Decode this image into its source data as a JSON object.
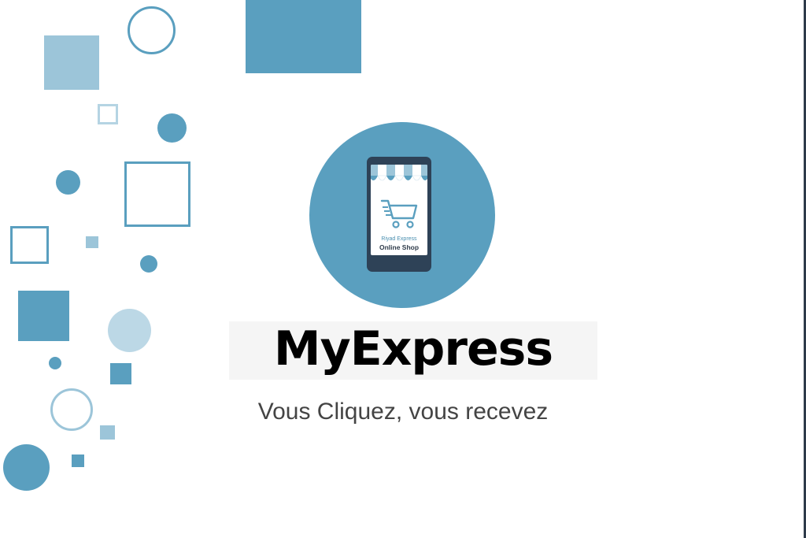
{
  "brand": {
    "name": "MyExpress",
    "tagline": "Vous Cliquez, vous recevez"
  },
  "logo": {
    "store_line1": "Riyad Express",
    "store_line2": "Online Shop",
    "icons": [
      "shop-awning-icon",
      "shopping-cart-icon",
      "smartphone-icon"
    ]
  },
  "colors": {
    "accent": "#5a9fbf",
    "accent_light": "#9cc5d9",
    "phone": "#2e4257",
    "title": "#000000",
    "tagline": "#444444"
  }
}
